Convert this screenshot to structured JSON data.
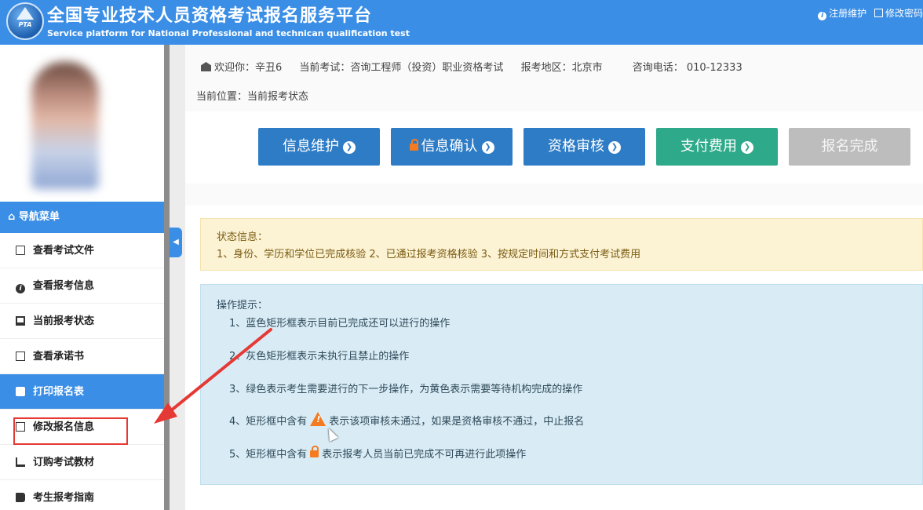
{
  "header": {
    "logo_text": "PTA",
    "title": "全国专业技术人员资格考试报名服务平台",
    "subtitle": "Service platform for National Professional and technican qualification test",
    "links": [
      {
        "label": "注册维护",
        "icon": "info-icon"
      },
      {
        "label": "修改密码",
        "icon": "edit-icon"
      }
    ]
  },
  "user_info": {
    "welcome": "欢迎你：辛丑6",
    "exam": "当前考试：咨询工程师（投资）职业资格考试",
    "region": "报考地区：北京市",
    "phone": "咨询电话：  010-12333"
  },
  "location": "当前位置：当前报考状态",
  "sidebar": {
    "nav_title": "导航菜单",
    "items": [
      {
        "label": "查看考试文件",
        "icon": "document-icon"
      },
      {
        "label": "查看报考信息",
        "icon": "info-icon"
      },
      {
        "label": "当前报考状态",
        "icon": "monitor-icon"
      },
      {
        "label": "查看承诺书",
        "icon": "card-icon"
      },
      {
        "label": "打印报名表",
        "icon": "print-icon",
        "active": true
      },
      {
        "label": "修改报名信息",
        "icon": "edit-icon",
        "highlighted": true
      },
      {
        "label": "订购考试教材",
        "icon": "cart-icon"
      },
      {
        "label": "考生报考指南",
        "icon": "book-icon"
      }
    ]
  },
  "steps": [
    {
      "label": "信息维护",
      "state": "done"
    },
    {
      "label": "信息确认",
      "state": "locked"
    },
    {
      "label": "资格审核",
      "state": "done"
    },
    {
      "label": "支付费用",
      "state": "next"
    },
    {
      "label": "报名完成",
      "state": "disabled"
    }
  ],
  "status": {
    "title": "状态信息：",
    "text": "1、身份、学历和学位已完成核验 2、已通过报考资格核验 3、按规定时间和方式支付考试费用"
  },
  "tips": {
    "title": "操作提示：",
    "items": [
      "1、蓝色矩形框表示目前已完成还可以进行的操作",
      "2、灰色矩形框表示未执行且禁止的操作",
      "3、绿色表示考生需要进行的下一步操作，为黄色表示需要等待机构完成的操作",
      {
        "prefix": "4、矩形框中含有",
        "suffix": "表示该项审核未通过，如果是资格审核不通过，中止报名"
      },
      {
        "prefix": "5、矩形框中含有",
        "suffix": "表示报考人员当前已完成不可再进行此项操作"
      }
    ]
  },
  "colors": {
    "brand_blue": "#3a8ee6",
    "step_blue": "#2e7cc6",
    "step_green": "#2ea98a",
    "step_gray": "#bdbdbd",
    "warning_orange": "#f47b20",
    "annotation_red": "#e53935"
  }
}
